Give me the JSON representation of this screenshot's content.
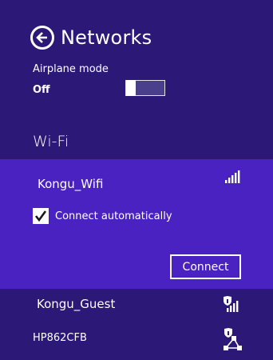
{
  "header": {
    "title": "Networks",
    "back_icon": "back-arrow-icon"
  },
  "airplane": {
    "label": "Airplane mode",
    "state": "Off",
    "toggle_on": false
  },
  "wifi": {
    "section_title": "Wi-Fi",
    "networks": [
      {
        "name": "Kongu_Wifi",
        "icon": "wifi-signal-icon",
        "selected": true,
        "secured": false
      },
      {
        "name": "Kongu_Guest",
        "icon": "wifi-signal-shield-icon",
        "secured": true
      },
      {
        "name": "HP862CFB",
        "icon": "adhoc-network-shield-icon",
        "secured": true
      }
    ],
    "connect_automatically": {
      "label": "Connect automatically",
      "checked": true
    },
    "connect_button": "Connect"
  },
  "colors": {
    "background": "#2b1877",
    "selected": "#4b22c2",
    "text": "#ffffff"
  }
}
